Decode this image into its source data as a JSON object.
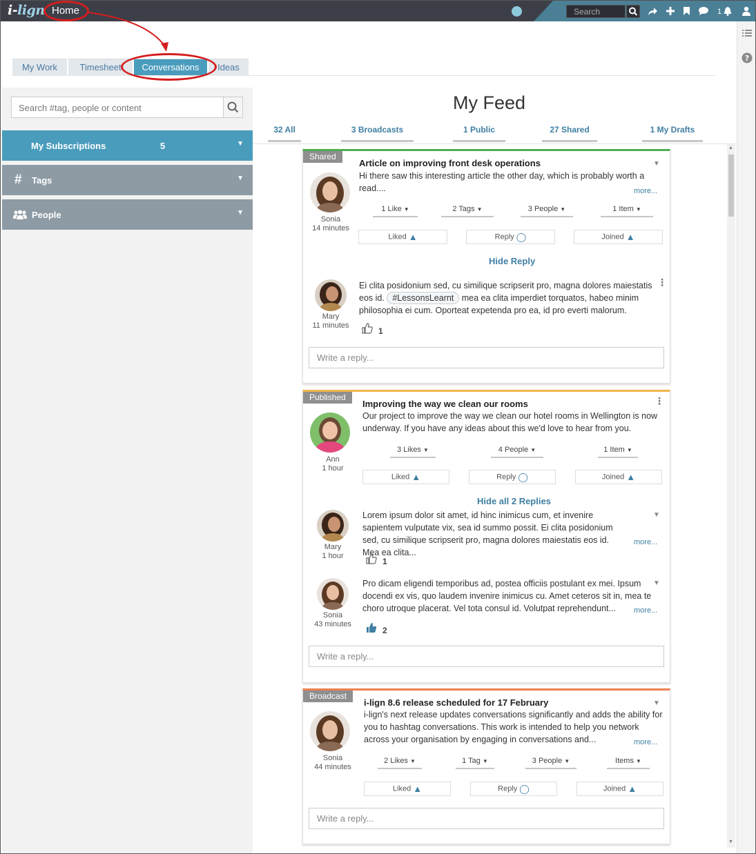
{
  "topbar": {
    "logo_i": "i-",
    "logo_rest": "lign",
    "home_label": "Home",
    "search_placeholder": "Search",
    "notification_count": "1",
    "colors": {
      "bar": "#3d3f48",
      "accent": "#4a7f96"
    }
  },
  "tabs": [
    {
      "label": "My Work"
    },
    {
      "label": "Timesheet"
    },
    {
      "label": "Conversations"
    },
    {
      "label": "Ideas"
    }
  ],
  "sidebar": {
    "search_placeholder": "Search #tag, people or content",
    "subscriptions": {
      "label": "My Subscriptions",
      "count": "5"
    },
    "tags": {
      "label": "Tags"
    },
    "people": {
      "label": "People"
    }
  },
  "feed": {
    "title": "My Feed",
    "filters": [
      {
        "label": "32 All"
      },
      {
        "label": "3 Broadcasts"
      },
      {
        "label": "1 Public"
      },
      {
        "label": "27 Shared"
      },
      {
        "label": "1 My Drafts"
      }
    ]
  },
  "cards": [
    {
      "badge": "Shared",
      "author": "Sonia",
      "time": "14 minutes",
      "title": "Article on improving front desk operations",
      "text": "Hi there saw this interesting article the other day, which is probably worth a read....",
      "more": "more...",
      "stats": [
        "1 Like",
        "2 Tags",
        "3 People",
        "1 Item"
      ],
      "actions": [
        "Liked",
        "Reply",
        "Joined"
      ],
      "toggle": "Hide Reply",
      "replies": [
        {
          "author": "Mary",
          "time": "11 minutes",
          "text_before": "Ei clita posidonium sed, cu similique scripserit pro, magna dolores maiestatis eos id.",
          "tag": "#LessonsLearnt",
          "text_after": "mea ea clita imperdiet torquatos, habeo minim philosophia ei cum. Oporteat expetenda pro ea, id pro everti malorum.",
          "likes": "1"
        }
      ],
      "reply_placeholder": "Write a reply..."
    },
    {
      "badge": "Published",
      "author": "Ann",
      "time": "1 hour",
      "title": "Improving the way we clean our rooms",
      "text": "Our project to improve the way we clean our hotel rooms in Wellington is now underway.  If you have any ideas about this we'd love to hear from you.",
      "stats": [
        "3 Likes",
        "4 People",
        "1 Item"
      ],
      "actions": [
        "Liked",
        "Reply",
        "Joined"
      ],
      "toggle": "Hide all 2 Replies",
      "replies": [
        {
          "author": "Mary",
          "time": "1 hour",
          "text": "Lorem ipsum dolor sit amet, id hinc inimicus cum, et invenire sapientem vulputate vix, sea id summo possit. Ei clita posidonium sed, cu similique scripserit pro, magna dolores maiestatis eos id. Mea ea clita...",
          "more": "more...",
          "likes": "1"
        },
        {
          "author": "Sonia",
          "time": "43 minutes",
          "text": "Pro dicam eligendi temporibus ad, postea officiis postulant ex mei. Ipsum docendi ex vis, quo laudem invenire inimicus cu. Amet ceteros sit in, mea te choro utroque placerat. Vel tota consul id. Volutpat reprehendunt...",
          "more": "more...",
          "likes": "2"
        }
      ],
      "reply_placeholder": "Write a reply..."
    },
    {
      "badge": "Broadcast",
      "author": "Sonia",
      "time": "44 minutes",
      "title": "i-lign 8.6 release scheduled for 17 February",
      "text": "i-lign's next release updates conversations significantly and adds the ability for you to hashtag conversations.  This work is intended to help you network across your organisation by engaging in conversations and...",
      "more": "more...",
      "stats": [
        "2 Likes",
        "1 Tag",
        "3 People",
        "Items"
      ],
      "actions": [
        "Liked",
        "Reply",
        "Joined"
      ],
      "reply_placeholder": "Write a reply..."
    }
  ]
}
